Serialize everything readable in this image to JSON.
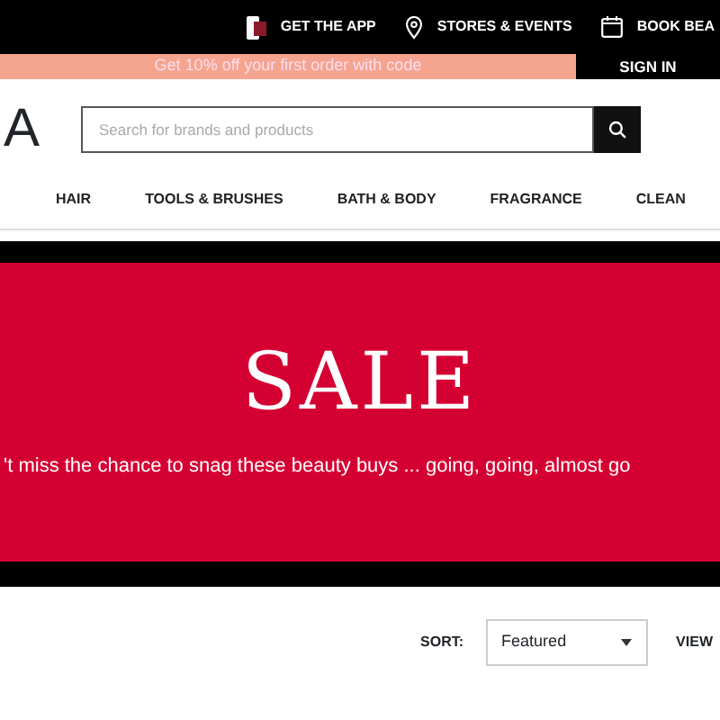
{
  "top_bar": {
    "links": [
      {
        "kind": "phone",
        "label": "GET THE APP"
      },
      {
        "kind": "pin",
        "label": "STORES & EVENTS"
      },
      {
        "kind": "calendar",
        "label": "BOOK BEA"
      }
    ],
    "sign_in": "SIGN IN"
  },
  "promo": "Get 10% off your first order with code",
  "logo": "A",
  "search": {
    "placeholder": "Search for brands and products"
  },
  "nav": [
    "HAIR",
    "TOOLS & BRUSHES",
    "BATH & BODY",
    "FRAGRANCE",
    "CLEAN"
  ],
  "banner": {
    "title": "SALE",
    "subtitle": "'t miss the chance to snag these beauty buys ... going, going, almost go"
  },
  "sort": {
    "label": "SORT:",
    "value": "Featured",
    "view": "VIEW"
  }
}
